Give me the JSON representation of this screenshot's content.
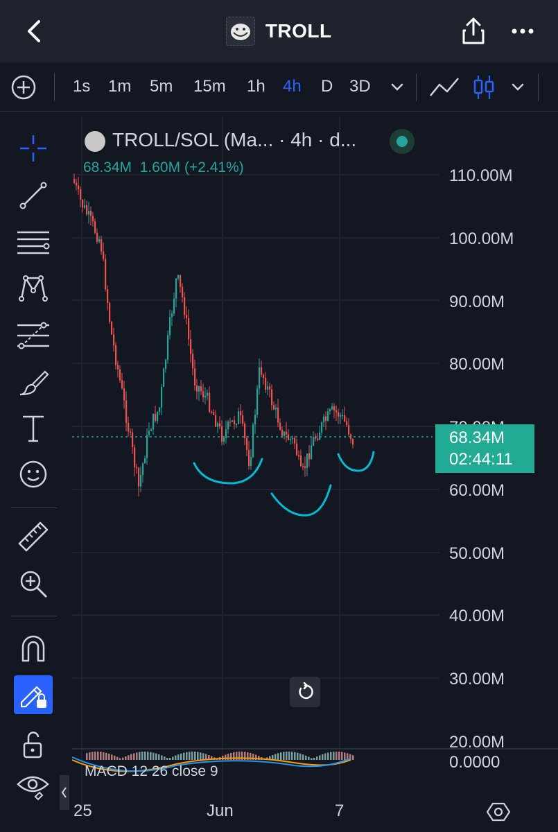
{
  "header": {
    "title": "TROLL",
    "icons": {
      "back": "chevron-left-icon",
      "share": "share-icon",
      "more": "more-icon"
    }
  },
  "toolbar": {
    "add_icon": "plus-circle-icon",
    "timeframes": [
      {
        "label": "1s",
        "active": false
      },
      {
        "label": "1m",
        "active": false
      },
      {
        "label": "5m",
        "active": false
      },
      {
        "label": "15m",
        "active": false
      },
      {
        "label": "1h",
        "active": false
      },
      {
        "label": "4h",
        "active": true
      },
      {
        "label": "D",
        "active": false
      },
      {
        "label": "3D",
        "active": false
      }
    ],
    "timeframe_dropdown_icon": "chevron-down-icon",
    "drawing_icon": "trend-line-icon",
    "chart_type_icon": "candlestick-icon",
    "chart_type_dropdown_icon": "chevron-down-icon"
  },
  "left_tools": [
    "crosshair-icon",
    "trend-line-tool-icon",
    "horizontal-lines-icon",
    "pattern-icon",
    "forecast-icon",
    "brush-icon",
    "text-tool-icon",
    "emoji-icon",
    "ruler-icon",
    "zoom-in-icon",
    "magnet-icon",
    "lock-drawings-icon",
    "unlock-icon",
    "eye-icon"
  ],
  "chart": {
    "symbol": "TROLL/SOL (Ma... · 4h · d...",
    "ohlc": {
      "last": "68.34M",
      "change": "1.60M",
      "change_pct": "(+2.41%)"
    },
    "price_tag": {
      "value": "68.34M",
      "countdown": "02:44:11"
    },
    "y_ticks": [
      "110.00M",
      "100.00M",
      "90.00M",
      "80.00M",
      "70.00M",
      "60.00M",
      "50.00M",
      "40.00M",
      "30.00M",
      "20.00M",
      "0.0000"
    ],
    "x_ticks": [
      "25",
      "Jun",
      "7"
    ],
    "macd_label": "MACD 12 26 close 9",
    "colors": {
      "up": "#26a69a",
      "down": "#ef5350",
      "annotation": "#00bcd4",
      "accent": "#2962ff"
    }
  }
}
